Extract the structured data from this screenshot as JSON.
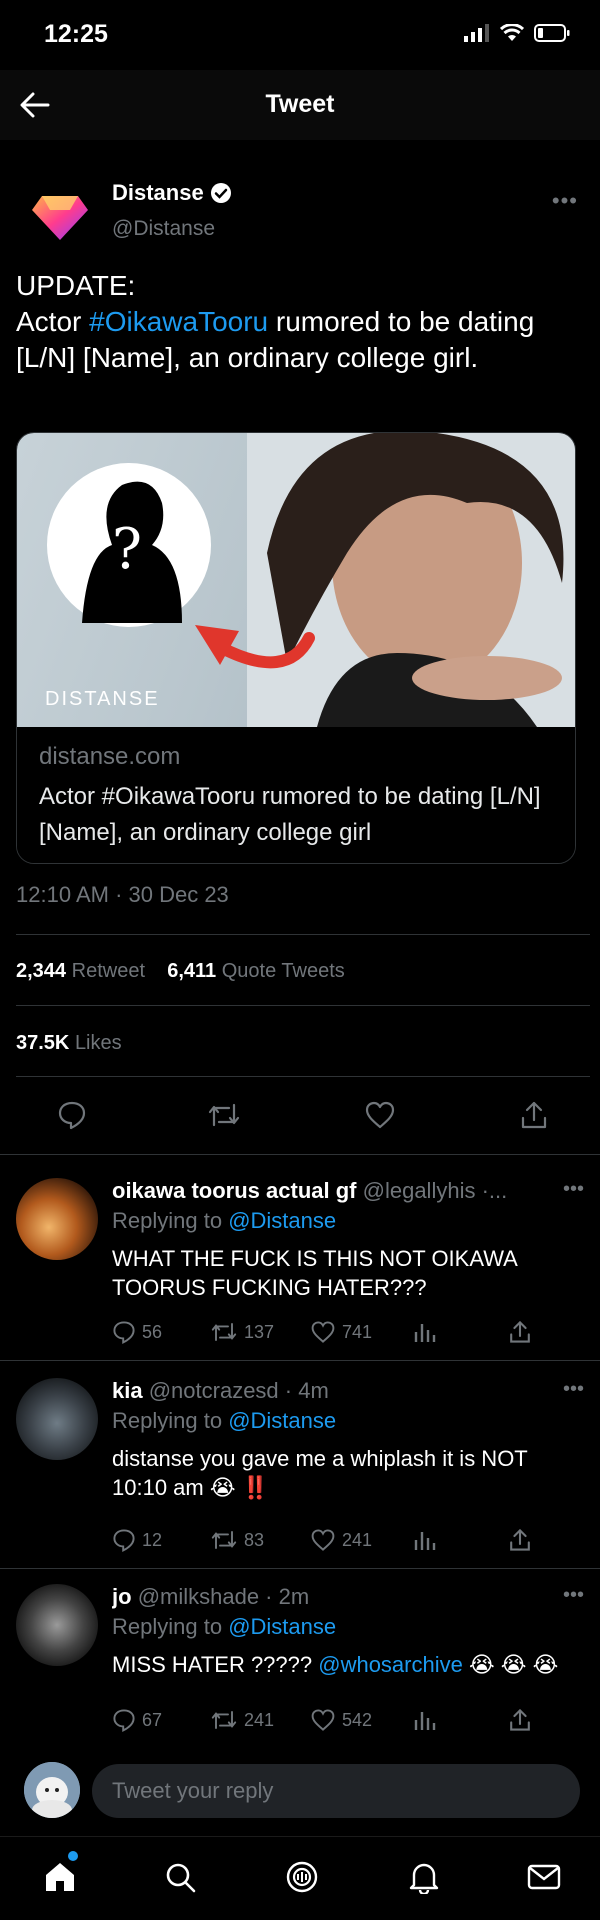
{
  "status_bar": {
    "time": "12:25"
  },
  "header": {
    "title": "Tweet"
  },
  "tweet": {
    "author_name": "Distanse",
    "author_handle": "@Distanse",
    "text_line1": "UPDATE:",
    "text_prefix": "Actor ",
    "hashtag": "#OikawaTooru",
    "text_suffix": " rumored to be dating [L/N] [Name], an ordinary college girl.",
    "image_watermark": "DISTANSE",
    "image_question": "?",
    "card_domain": "distanse.com",
    "card_title": "Actor #OikawaTooru rumored to be dating [L/N] [Name], an ordinary college girl",
    "timestamp": "12:10 AM · 30 Dec 23",
    "retweets": "2,344",
    "retweets_label": "Retweet",
    "quotes": "6,411",
    "quotes_label": "Quote Tweets",
    "likes": "37.5K",
    "likes_label": "Likes"
  },
  "replies": [
    {
      "name": "oikawa toorus actual gf",
      "handle_time": "@legallyhis ·...",
      "replying_prefix": "Replying to ",
      "replying_to": "@Distanse",
      "text": "WHAT THE FUCK IS THIS NOT OIKAWA TOORUS FUCKING HATER???",
      "text_extra": "",
      "replies": "56",
      "retweets": "137",
      "likes": "741"
    },
    {
      "name": "kia",
      "handle_time": "@notcrazesd · 4m",
      "replying_prefix": "Replying to ",
      "replying_to": "@Distanse",
      "text": "distanse you gave me a whiplash it is NOT 10:10 am 😭 ",
      "text_extra": "‼️",
      "replies": "12",
      "retweets": "83",
      "likes": "241"
    },
    {
      "name": "jo",
      "handle_time": "@milkshade · 2m",
      "replying_prefix": "Replying to ",
      "replying_to": "@Distanse",
      "text": "MISS HATER ????? ",
      "text_mention": "@whosarchive",
      "text_extra": " 😭 😭 😭",
      "replies": "67",
      "retweets": "241",
      "likes": "542"
    }
  ],
  "composer": {
    "placeholder": "Tweet your reply"
  },
  "colors": {
    "accent": "#1d9bf0",
    "background": "#000000",
    "muted": "#71767b",
    "red": "#e0362c"
  }
}
